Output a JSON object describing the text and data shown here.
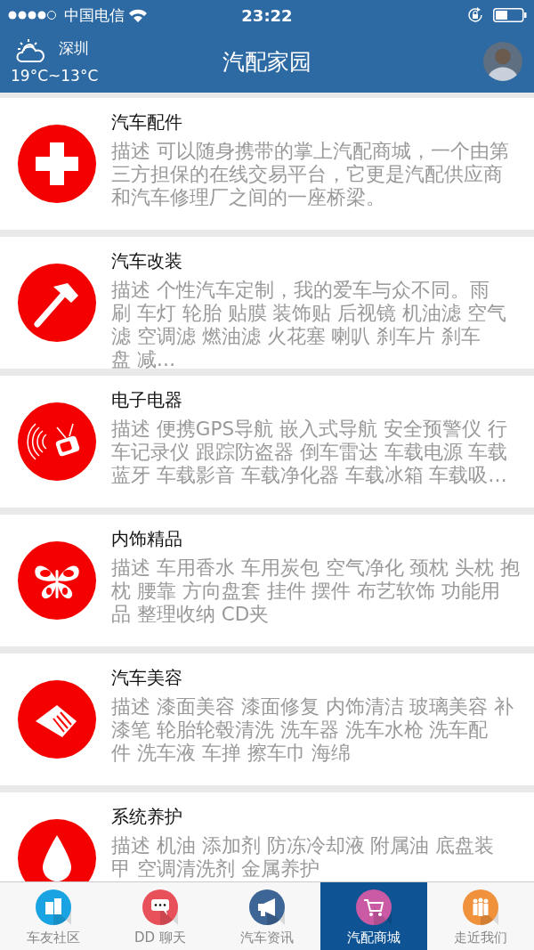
{
  "status_bar": {
    "carrier": "中国电信",
    "time": "23:22"
  },
  "header": {
    "city": "深圳",
    "temperature": "19°C~13°C",
    "title": "汽配家园"
  },
  "categories": [
    {
      "title": "汽车配件",
      "description": "描述 可以随身携带的掌上汽配商城，一个由第三方担保的在线交易平台，它更是汽配供应商和汽车修理厂之间的一座桥梁。"
    },
    {
      "title": "汽车改装",
      "description": "描述 个性汽车定制，我的爱车与众不同。雨刷 车灯 轮胎 贴膜 装饰贴 后视镜 机油滤 空气滤 空调滤 燃油滤 火花塞 喇叭 刹车片 刹车盘 减…"
    },
    {
      "title": "电子电器",
      "description": "描述 便携GPS导航 嵌入式导航 安全预警仪 行车记录仪 跟踪防盗器 倒车雷达 车载电源 车载蓝牙 车载影音 车载净化器 车载冰箱 车载吸…"
    },
    {
      "title": "内饰精品",
      "description": "描述 车用香水 车用炭包 空气净化 颈枕 头枕 抱枕 腰靠 方向盘套 挂件 摆件 布艺软饰 功能用品 整理收纳 CD夹"
    },
    {
      "title": "汽车美容",
      "description": "描述 漆面美容 漆面修复 内饰清洁 玻璃美容 补漆笔 轮胎轮毂清洗 洗车器 洗车水枪 洗车配件 洗车液 车掸 擦车巾 海绵"
    },
    {
      "title": "系统养护",
      "description": "描述 机油 添加剂 防冻冷却液 附属油 底盘装甲 空调清洗剂 金属养护"
    }
  ],
  "tabs": [
    {
      "label": "车友社区",
      "selected": false,
      "color": "#1aa3e3"
    },
    {
      "label": "DD 聊天",
      "selected": false,
      "color": "#e8505a"
    },
    {
      "label": "汽车资讯",
      "selected": false,
      "color": "#3d6595"
    },
    {
      "label": "汽配商城",
      "selected": true,
      "color": "#c95aa3"
    },
    {
      "label": "走近我们",
      "selected": false,
      "color": "#f0913c"
    }
  ]
}
